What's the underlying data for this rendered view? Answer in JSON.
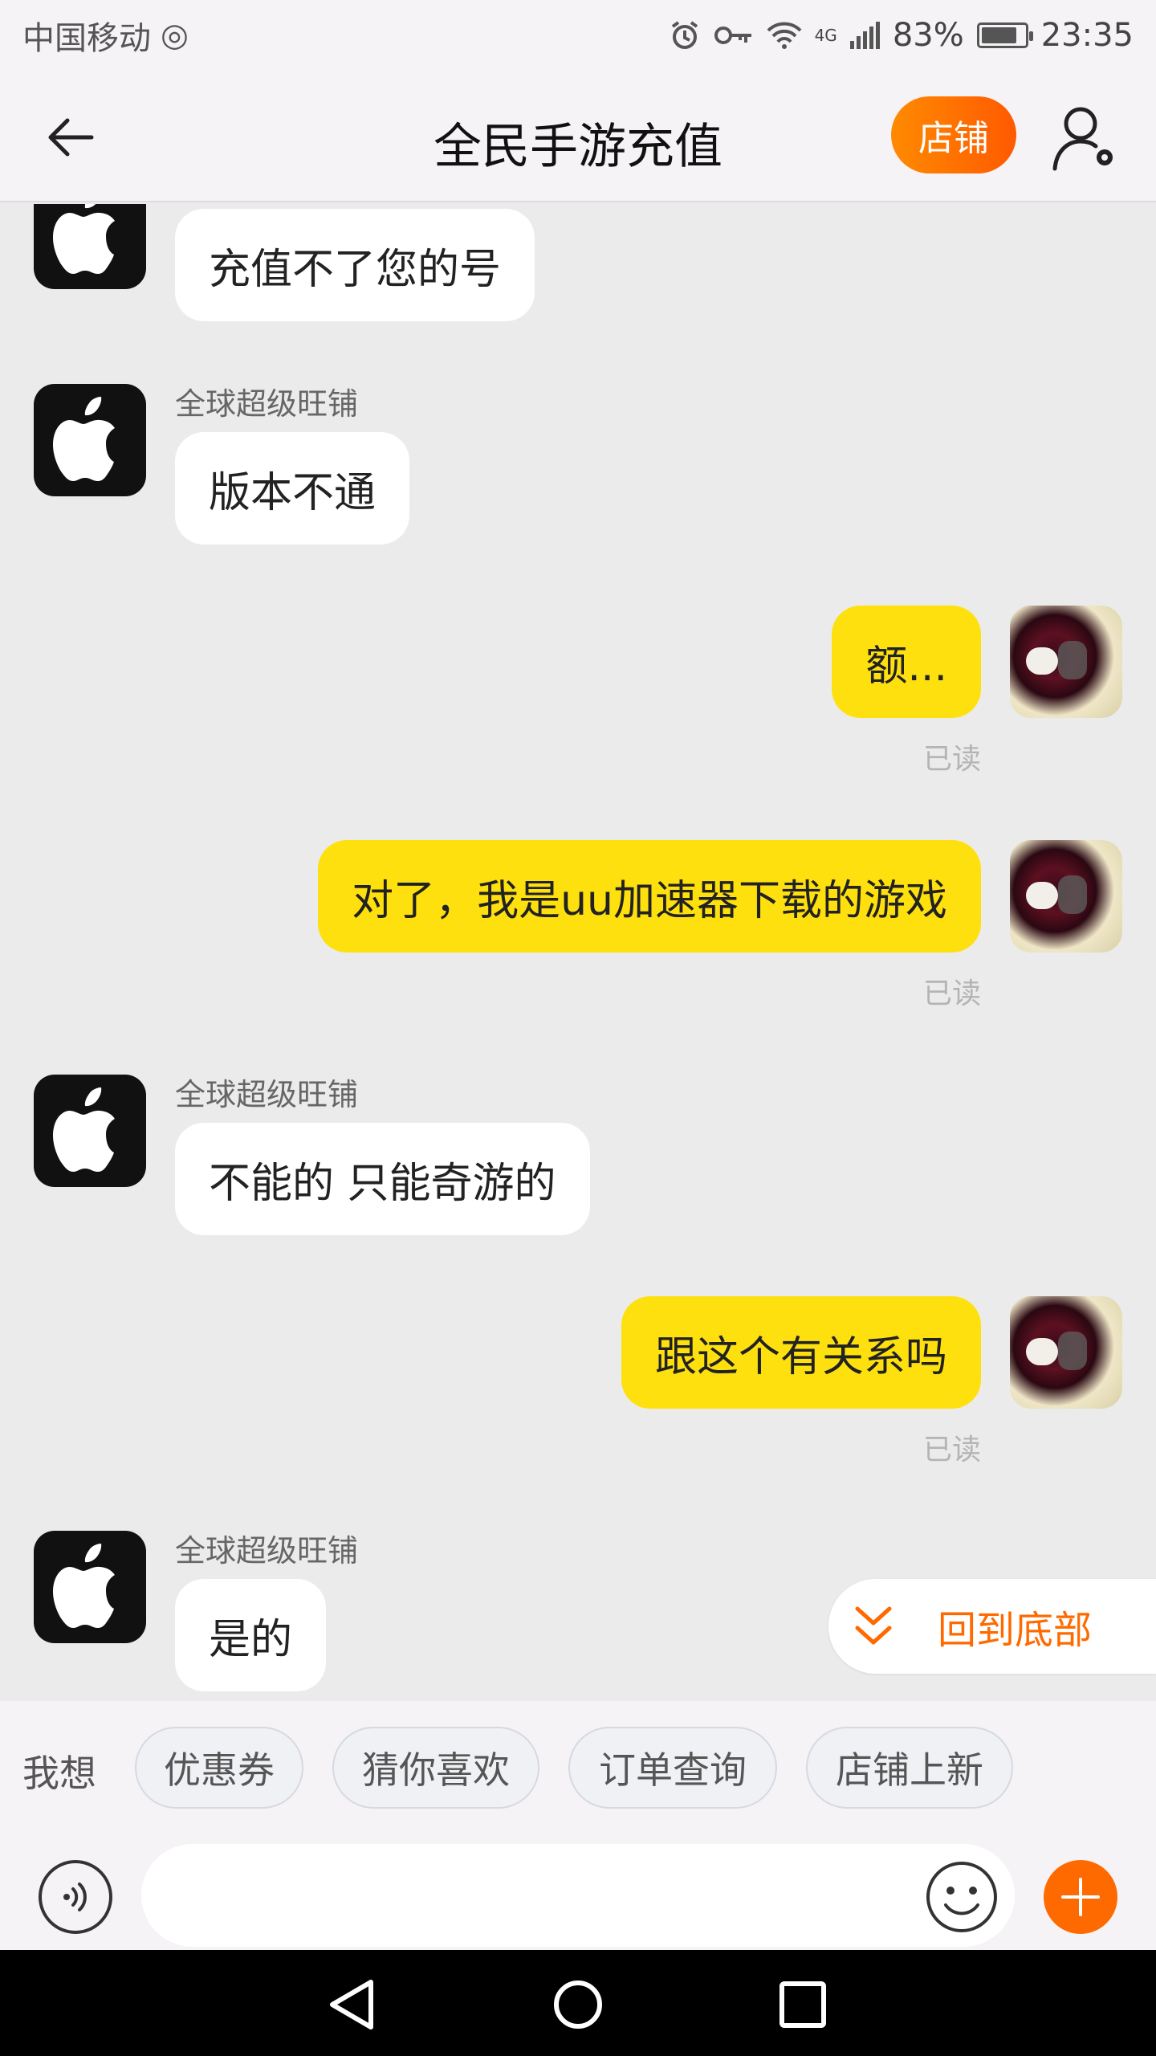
{
  "status_bar": {
    "carrier": "中国移动",
    "network": "4G",
    "battery": "83%",
    "battery_level": 0.83,
    "time": "23:35"
  },
  "header": {
    "title": "全民手游充值",
    "shop_button": "店铺",
    "icons": {
      "back": "arrow-left-icon",
      "settings": "user-settings-icon"
    }
  },
  "messages": [
    {
      "direction": "in",
      "sender": "",
      "text": "充值不了您的号"
    },
    {
      "direction": "in",
      "sender": "全球超级旺铺",
      "text": "版本不通"
    },
    {
      "direction": "out",
      "text": "额...",
      "status": "已读"
    },
    {
      "direction": "out",
      "text": "对了，我是uu加速器下载的游戏",
      "status": "已读"
    },
    {
      "direction": "in",
      "sender": "全球超级旺铺",
      "text": "不能的 只能奇游的"
    },
    {
      "direction": "out",
      "text": "跟这个有关系吗",
      "status": "已读"
    },
    {
      "direction": "in",
      "sender": "全球超级旺铺",
      "text": "是的"
    }
  ],
  "back_to_bottom": {
    "label": "回到底部"
  },
  "quick_replies": {
    "prefix": "我想",
    "chips": [
      "优惠券",
      "猜你喜欢",
      "订单查询",
      "店铺上新"
    ]
  },
  "input": {
    "placeholder": "",
    "value": ""
  },
  "colors": {
    "accent": "#ff6a00",
    "outgoing_bubble": "#ffe00f",
    "incoming_bubble": "#ffffff",
    "chat_background": "#ebebeb"
  }
}
